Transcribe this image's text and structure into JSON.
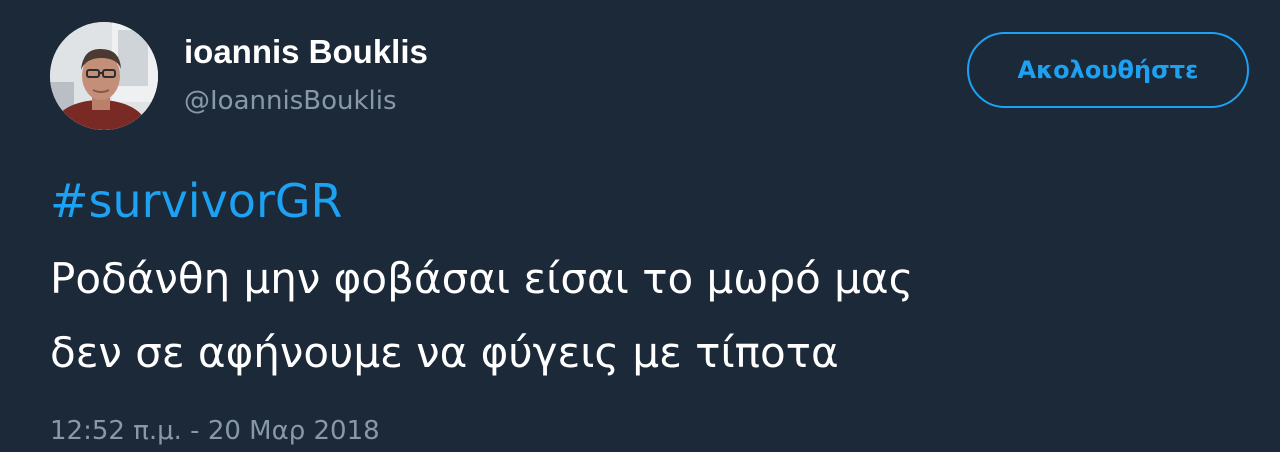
{
  "user": {
    "display_name": "ioannis Bouklis",
    "handle": "@IoannisBouklis"
  },
  "follow_button": {
    "label": "Ακολουθήστε"
  },
  "tweet": {
    "hashtag": "#survivorGR",
    "line1": "Ροδάνθη μην φοβάσαι είσαι το μωρό μας",
    "line2": "δεν σε αφήνουμε να φύγεις με τίποτα",
    "timestamp": "12:52 π.μ. - 20 Μαρ 2018"
  },
  "colors": {
    "background": "#1c2938",
    "accent": "#1da1f2",
    "text": "#ffffff",
    "muted": "#8899a6"
  },
  "icons": {
    "avatar": "user-photo"
  }
}
